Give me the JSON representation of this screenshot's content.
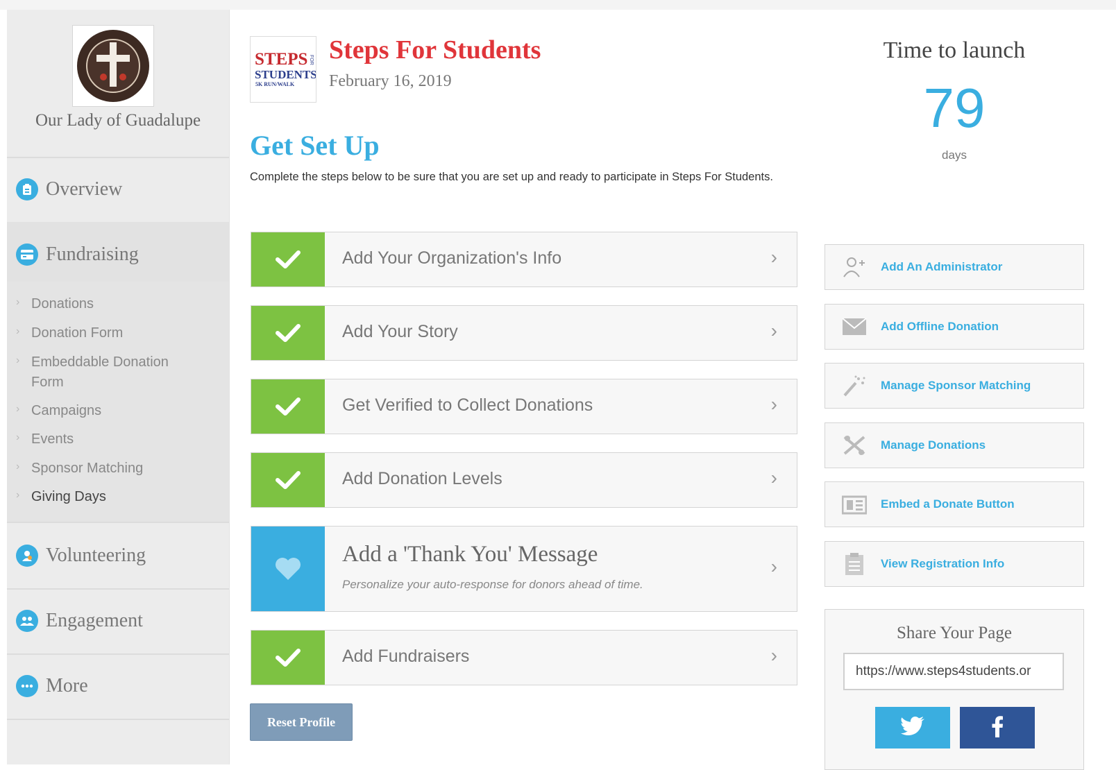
{
  "sidebar": {
    "org_name": "Our Lady of Guadalupe",
    "nav": {
      "overview": "Overview",
      "fundraising": "Fundraising",
      "volunteering": "Volunteering",
      "engagement": "Engagement",
      "more": "More"
    },
    "sub_items": [
      "Donations",
      "Donation Form",
      "Embeddable Donation Form",
      "Campaigns",
      "Events",
      "Sponsor Matching",
      "Giving Days"
    ]
  },
  "header": {
    "title": "Steps For Students",
    "date": "February 16, 2019",
    "logo_text": {
      "line1": "STEPS",
      "line2": "STUDENTS",
      "line3": "5K RUN/WALK",
      "side": "FOR"
    }
  },
  "setup": {
    "heading": "Get Set Up",
    "description": "Complete the steps below to be sure that you are set up and ready to participate in Steps For Students."
  },
  "steps": [
    {
      "label": "Add Your Organization's Info",
      "status": "complete"
    },
    {
      "label": "Add Your Story",
      "status": "complete"
    },
    {
      "label": "Get Verified to Collect Donations",
      "status": "complete"
    },
    {
      "label": "Add Donation Levels",
      "status": "complete"
    },
    {
      "label": "Add a 'Thank You' Message",
      "status": "pending",
      "description": "Personalize your auto-response for donors ahead of time."
    },
    {
      "label": "Add Fundraisers",
      "status": "complete"
    }
  ],
  "reset_label": "Reset Profile",
  "launch": {
    "title": "Time to launch",
    "count": "79",
    "unit": "days"
  },
  "actions": [
    {
      "label": "Add An Administrator",
      "icon": "add-user-icon"
    },
    {
      "label": "Add Offline Donation",
      "icon": "envelope-icon"
    },
    {
      "label": "Manage Sponsor Matching",
      "icon": "magic-wand-icon"
    },
    {
      "label": "Manage Donations",
      "icon": "tools-icon"
    },
    {
      "label": "Embed a Donate Button",
      "icon": "embed-icon"
    },
    {
      "label": "View Registration Info",
      "icon": "clipboard-icon"
    }
  ],
  "share": {
    "heading": "Share Your Page",
    "url": "https://www.steps4students.or"
  },
  "colors": {
    "accent": "#3aaee0",
    "complete": "#7dc242",
    "title": "#e0353a",
    "facebook": "#2f5597"
  }
}
